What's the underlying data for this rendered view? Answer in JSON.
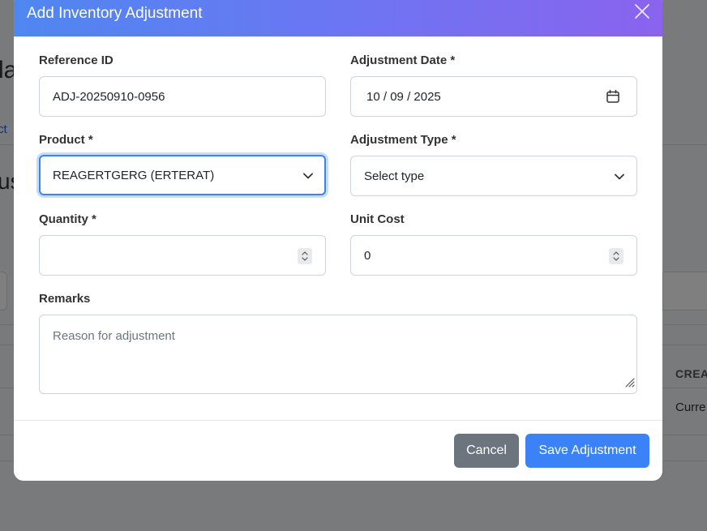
{
  "background": {
    "title_fragment": "la",
    "link_fragment": "ct",
    "heading_fragment": "us",
    "table_column_header": "CREAT",
    "table_cell": "Curre"
  },
  "modal": {
    "title": "Add Inventory Adjustment",
    "fields": {
      "reference_id": {
        "label": "Reference ID",
        "value": "ADJ-20250910-0956"
      },
      "adjustment_date": {
        "label": "Adjustment Date *",
        "month": "10",
        "sep1": "/",
        "day": "09",
        "sep2": "/",
        "year": "2025"
      },
      "product": {
        "label": "Product *",
        "selected": "REAGERTGERG (ERTERAT)"
      },
      "adjustment_type": {
        "label": "Adjustment Type *",
        "selected": "Select type"
      },
      "quantity": {
        "label": "Quantity *",
        "value": ""
      },
      "unit_cost": {
        "label": "Unit Cost",
        "value": "0"
      },
      "remarks": {
        "label": "Remarks",
        "placeholder": "Reason for adjustment"
      }
    },
    "buttons": {
      "cancel": "Cancel",
      "save": "Save Adjustment"
    },
    "colors": {
      "header_gradient_start": "#4f87f0",
      "header_gradient_end": "#8a63ee",
      "primary": "#3b82f6",
      "secondary": "#6c757d"
    },
    "icons": {
      "close": "close-icon",
      "calendar": "calendar-icon",
      "chevron": "chevron-down-icon",
      "spinner": "spinner-icon",
      "resize": "resize-handle-icon"
    }
  }
}
